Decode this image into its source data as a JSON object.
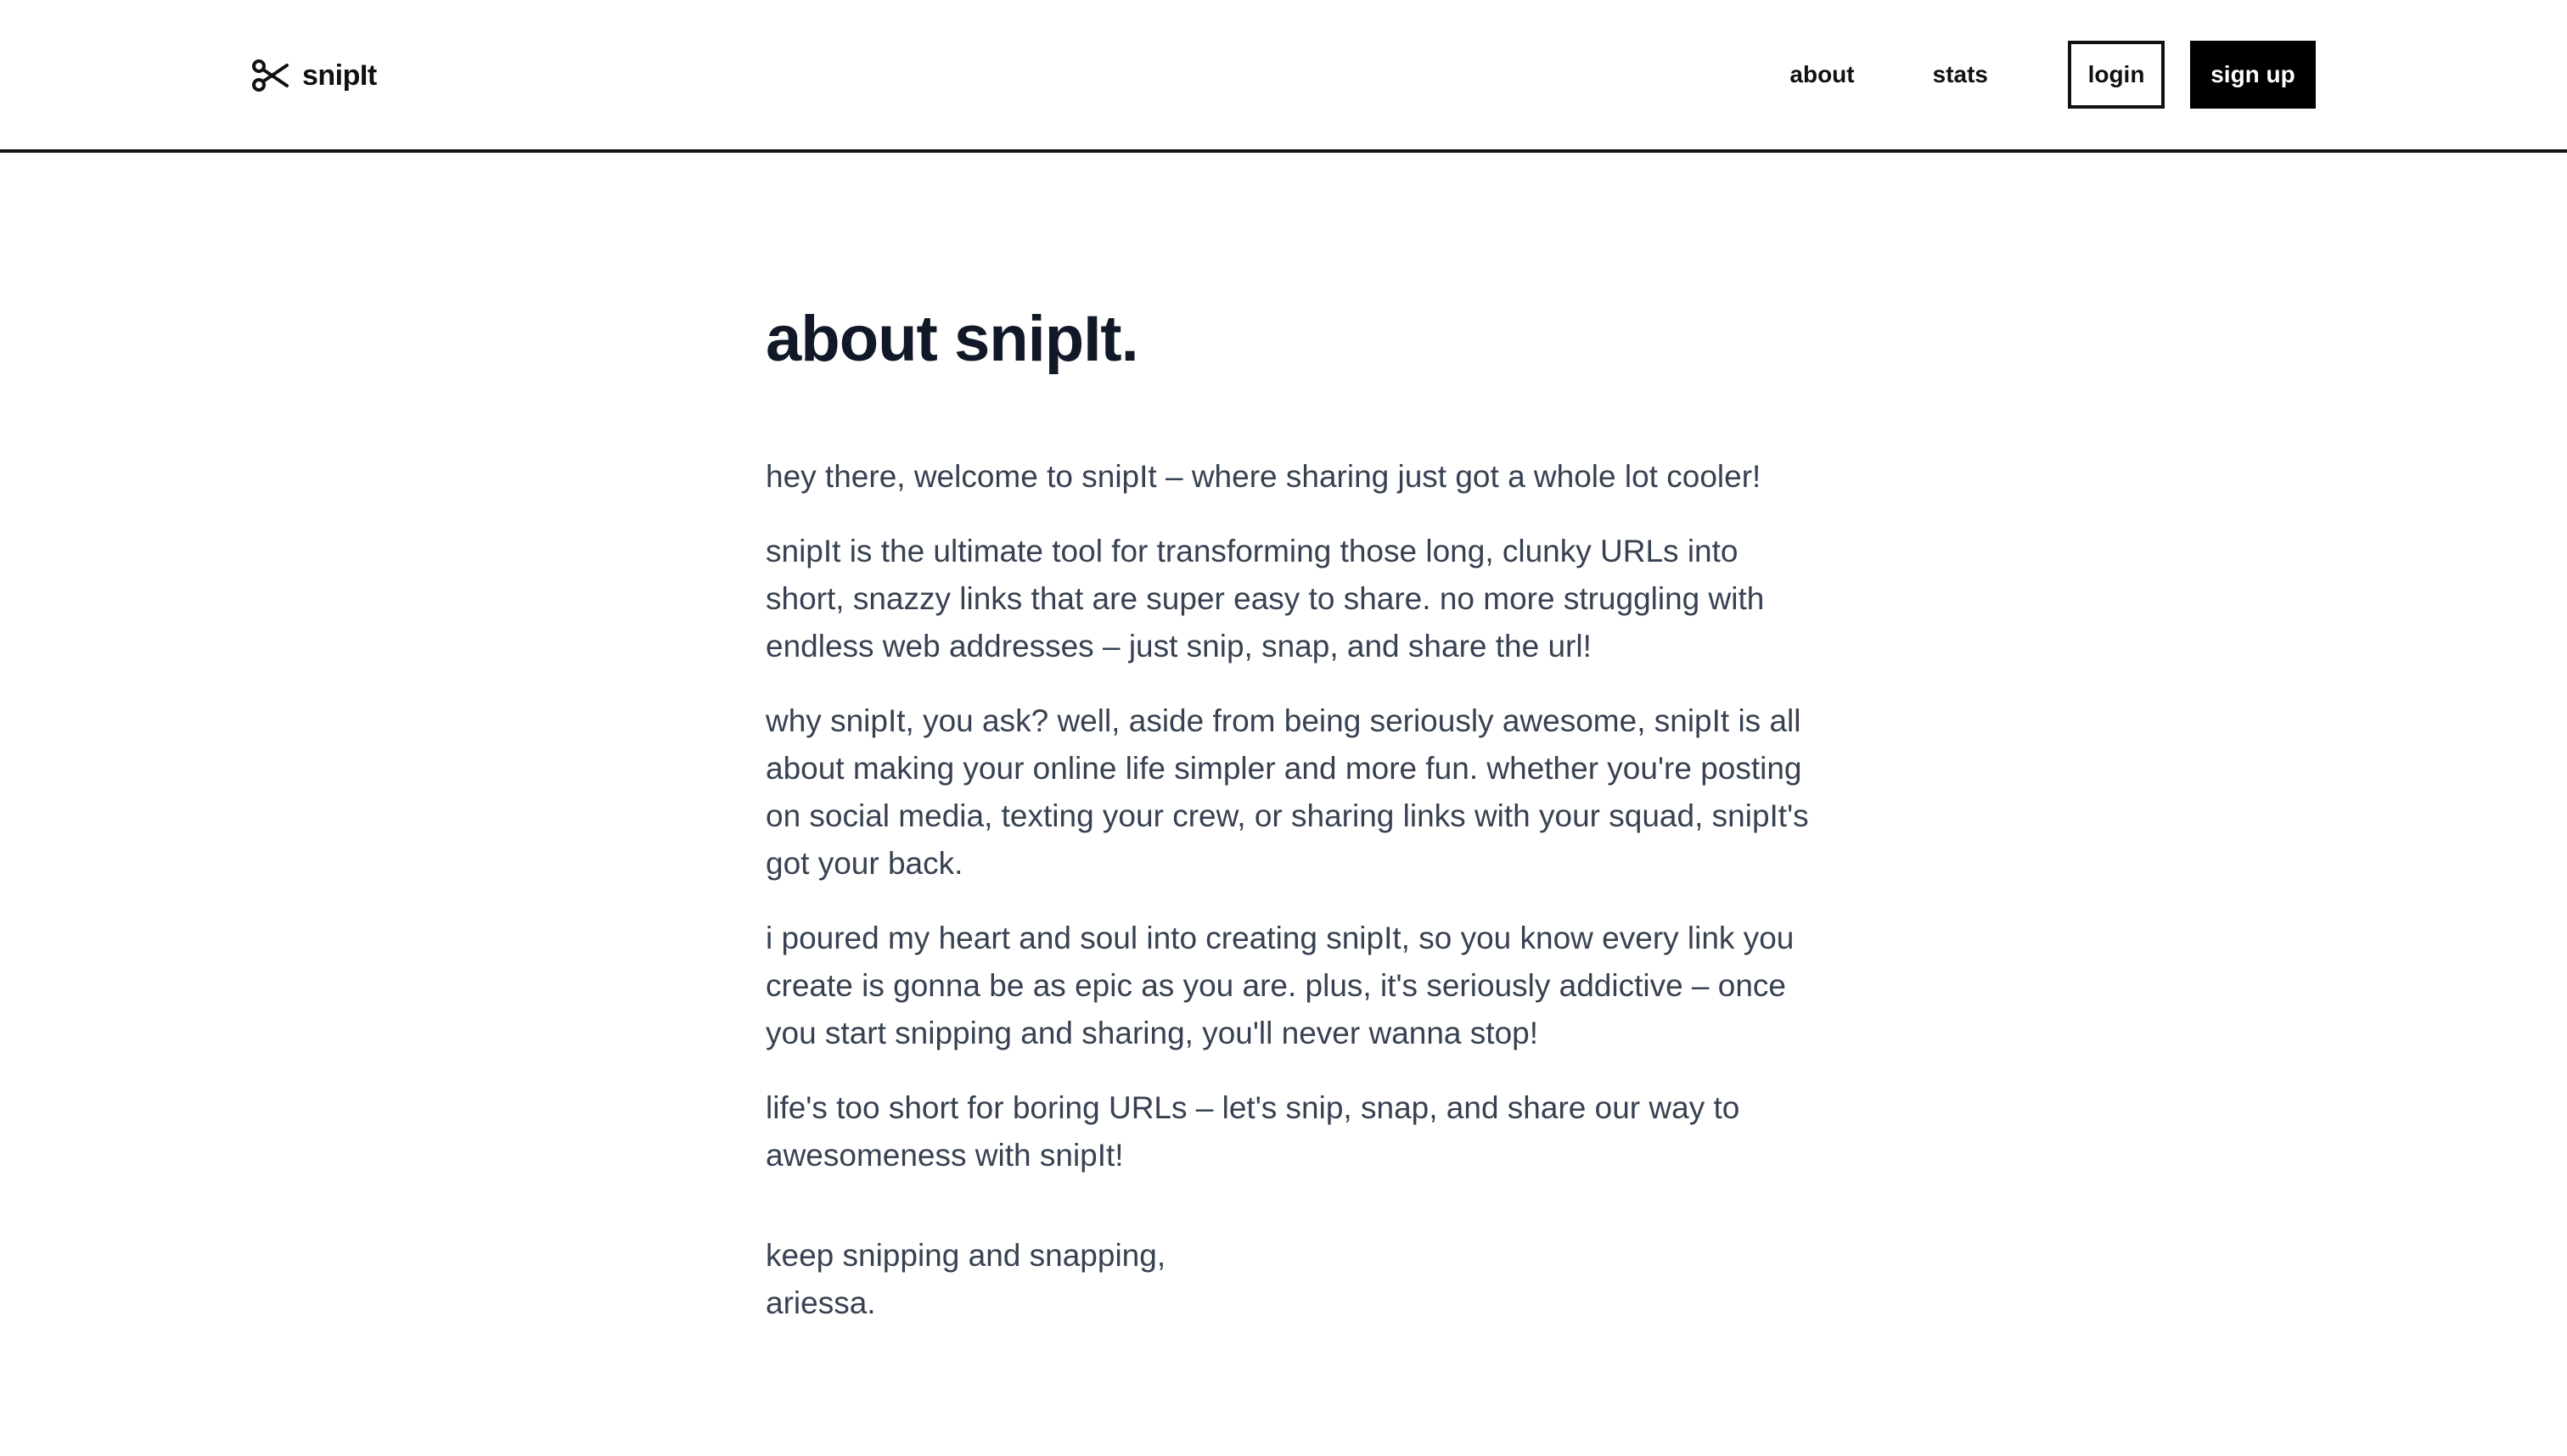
{
  "header": {
    "brand_name": "snipIt",
    "brand_icon": "scissors-icon",
    "nav": {
      "about_label": "about",
      "stats_label": "stats",
      "login_label": "login",
      "signup_label": "sign up"
    }
  },
  "main": {
    "title": "about snipIt.",
    "paragraphs": [
      "hey there, welcome to snipIt – where sharing just got a whole lot cooler!",
      "snipIt is the ultimate tool for transforming those long, clunky URLs into short, snazzy links that are super easy to share. no more struggling with endless web addresses – just snip, snap, and share the url!",
      "why snipIt, you ask? well, aside from being seriously awesome, snipIt is all about making your online life simpler and more fun. whether you're posting on social media, texting your crew, or sharing links with your squad, snipIt's got your back.",
      "i poured my heart and soul into creating snipIt, so you know every link you create is gonna be as epic as you are. plus, it's seriously addictive – once you start snipping and sharing, you'll never wanna stop!",
      "life's too short for boring URLs – let's snip, snap, and share our way to awesomeness with snipIt!"
    ],
    "signoff": {
      "line1": "keep snipping and snapping,",
      "line2": "ariessa."
    }
  },
  "colors": {
    "text_primary": "#111827",
    "text_body": "#374151",
    "accent": "#000000",
    "background": "#ffffff"
  }
}
